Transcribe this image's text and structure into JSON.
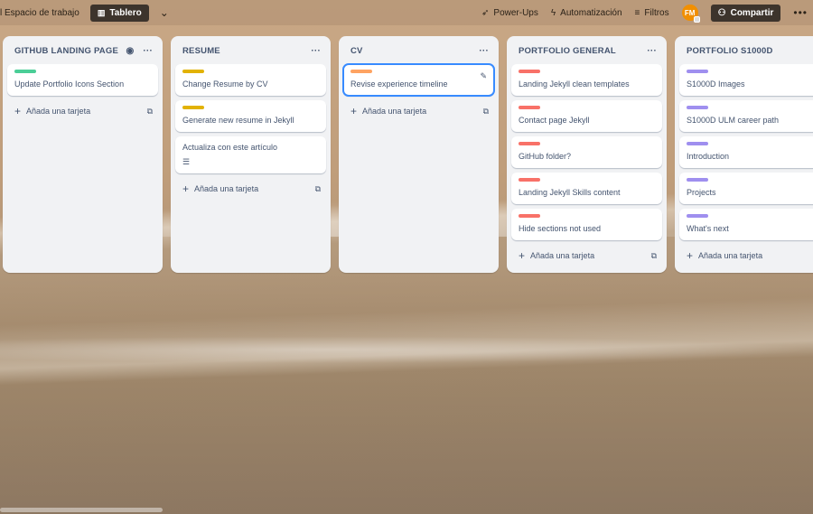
{
  "header": {
    "workspace_label": "l Espacio de trabajo",
    "board_view_label": "Tablero",
    "powerups_label": "Power-Ups",
    "automation_label": "Automatización",
    "filters_label": "Filtros",
    "avatar_initials": "FM",
    "share_label": "Compartir"
  },
  "colors": {
    "green": "#4bce97",
    "yellow": "#e2b203",
    "orange": "#fea362",
    "red": "#f87168",
    "purple": "#9f8fef"
  },
  "lists": [
    {
      "title": "GITHUB LANDING PAGE",
      "watch": true,
      "cards": [
        {
          "label_color": "green",
          "text": "Update Portfolio Icons Section"
        }
      ],
      "add_label": "Añada una tarjeta"
    },
    {
      "title": "RESUME",
      "cards": [
        {
          "label_color": "yellow",
          "text": "Change Resume by CV"
        },
        {
          "label_color": "yellow",
          "text": "Generate new resume in Jekyll"
        },
        {
          "label_color": null,
          "text": "Actualiza con este artículo",
          "has_description": true
        }
      ],
      "add_label": "Añada una tarjeta"
    },
    {
      "title": "CV",
      "cards": [
        {
          "label_color": "orange",
          "text": "Revise experience timeline",
          "selected": true
        }
      ],
      "add_label": "Añada una tarjeta"
    },
    {
      "title": "PORTFOLIO GENERAL",
      "cards": [
        {
          "label_color": "red",
          "text": "Landing Jekyll clean templates"
        },
        {
          "label_color": "red",
          "text": "Contact page Jekyll"
        },
        {
          "label_color": "red",
          "text": "GitHub folder?"
        },
        {
          "label_color": "red",
          "text": "Landing Jekyll Skills content"
        },
        {
          "label_color": "red",
          "text": "Hide sections not used"
        }
      ],
      "add_label": "Añada una tarjeta"
    },
    {
      "title": "PORTFOLIO S1000D",
      "cards": [
        {
          "label_color": "purple",
          "text": "S1000D Images"
        },
        {
          "label_color": "purple",
          "text": "S1000D ULM career path"
        },
        {
          "label_color": "purple",
          "text": "Introduction"
        },
        {
          "label_color": "purple",
          "text": "Projects"
        },
        {
          "label_color": "purple",
          "text": "What's next"
        }
      ],
      "add_label": "Añada una tarjeta"
    }
  ]
}
